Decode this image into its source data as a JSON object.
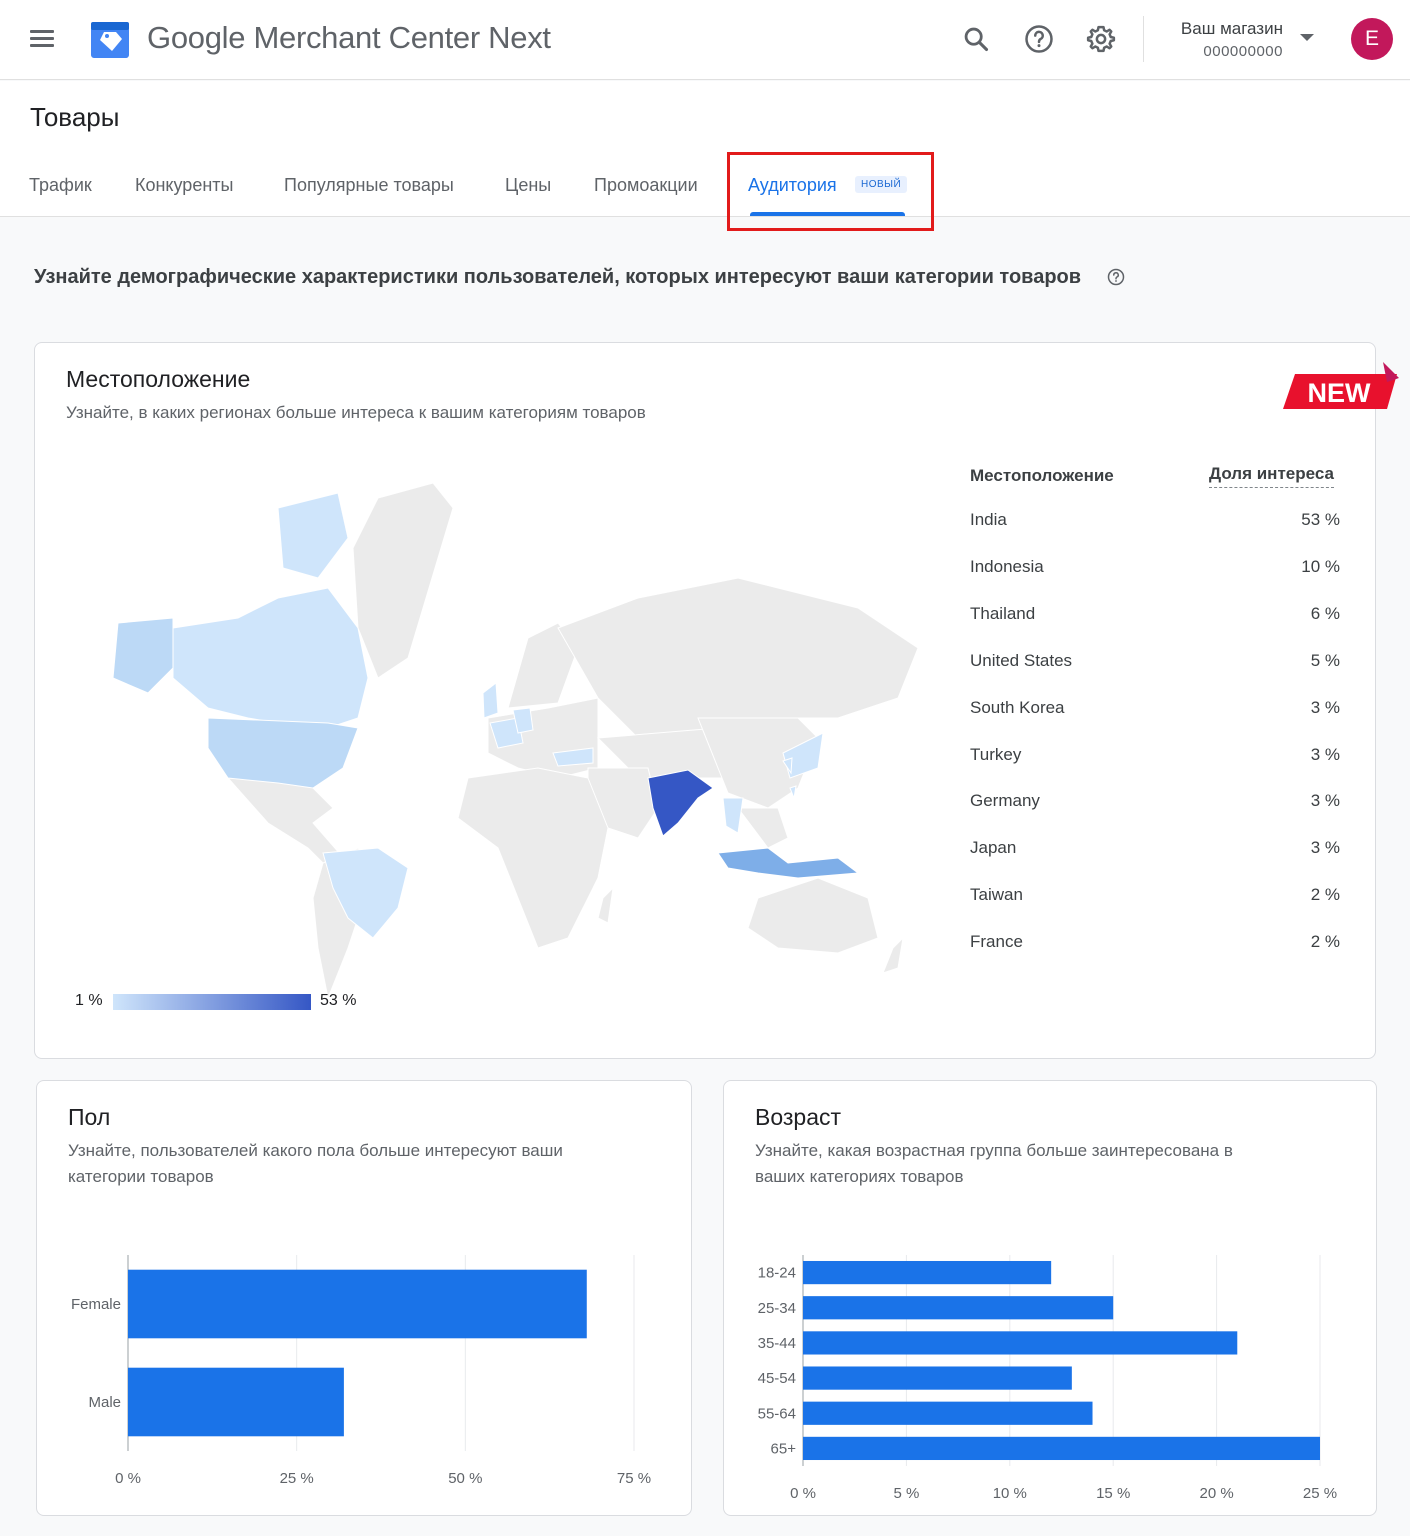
{
  "topbar": {
    "app_title": "Google Merchant Center Next",
    "store_name": "Ваш магазин",
    "store_id": "000000000",
    "avatar_letter": "E",
    "icons": [
      "menu-icon",
      "merchant-logo",
      "search-icon",
      "help-icon",
      "settings-icon",
      "dropdown-icon"
    ]
  },
  "page": {
    "title": "Товары",
    "tabs": [
      {
        "label": "Трафик"
      },
      {
        "label": "Конкуренты"
      },
      {
        "label": "Популярные товары"
      },
      {
        "label": "Цены"
      },
      {
        "label": "Промоакции"
      },
      {
        "label": "Аудитория",
        "badge": "НОВЫЙ",
        "active": true
      }
    ],
    "subtitle": "Узнайте демографические характеристики пользователей, которых интересуют ваши категории товаров"
  },
  "location": {
    "title": "Местоположение",
    "description": "Узнайте, в каких регионах больше интереса к вашим категориям товаров",
    "ribbon": "NEW",
    "legend_min": "1 %",
    "legend_max": "53 %",
    "col_location": "Местоположение",
    "col_share": "Доля интереса",
    "rows": [
      {
        "name": "India",
        "value": "53 %"
      },
      {
        "name": "Indonesia",
        "value": "10 %"
      },
      {
        "name": "Thailand",
        "value": "6 %"
      },
      {
        "name": "United States",
        "value": "5 %"
      },
      {
        "name": "South Korea",
        "value": "3 %"
      },
      {
        "name": "Turkey",
        "value": "3 %"
      },
      {
        "name": "Germany",
        "value": "3 %"
      },
      {
        "name": "Japan",
        "value": "3 %"
      },
      {
        "name": "Taiwan",
        "value": "2 %"
      },
      {
        "name": "France",
        "value": "2 %"
      }
    ],
    "colors": {
      "low": "#cfe5fb",
      "high": "#3557c5",
      "neutral": "#eeeeee"
    }
  },
  "gender": {
    "title": "Пол",
    "description_line1": "Узнайте, пользователей какого пола больше интересуют ваши",
    "description_line2": "категории товаров"
  },
  "age": {
    "title": "Возраст",
    "description_line1": "Узнайте, какая возрастная группа больше заинтересована в",
    "description_line2": "ваших категориях товаров"
  },
  "chart_data": [
    {
      "type": "bar",
      "orientation": "horizontal",
      "categories": [
        "Female",
        "Male"
      ],
      "values": [
        68,
        32
      ],
      "xlim": [
        0,
        75
      ],
      "ticks": [
        "0 %",
        "25 %",
        "50 %",
        "75 %"
      ],
      "tick_values": [
        0,
        25,
        50,
        75
      ],
      "color": "#1a73e8"
    },
    {
      "type": "bar",
      "orientation": "horizontal",
      "categories": [
        "18-24",
        "25-34",
        "35-44",
        "45-54",
        "55-64",
        "65+"
      ],
      "values": [
        12,
        15,
        21,
        13,
        14,
        25
      ],
      "xlim": [
        0,
        25
      ],
      "ticks": [
        "0 %",
        "5 %",
        "10 %",
        "15 %",
        "20 %",
        "25 %"
      ],
      "tick_values": [
        0,
        5,
        10,
        15,
        20,
        25
      ],
      "color": "#1a73e8"
    }
  ]
}
